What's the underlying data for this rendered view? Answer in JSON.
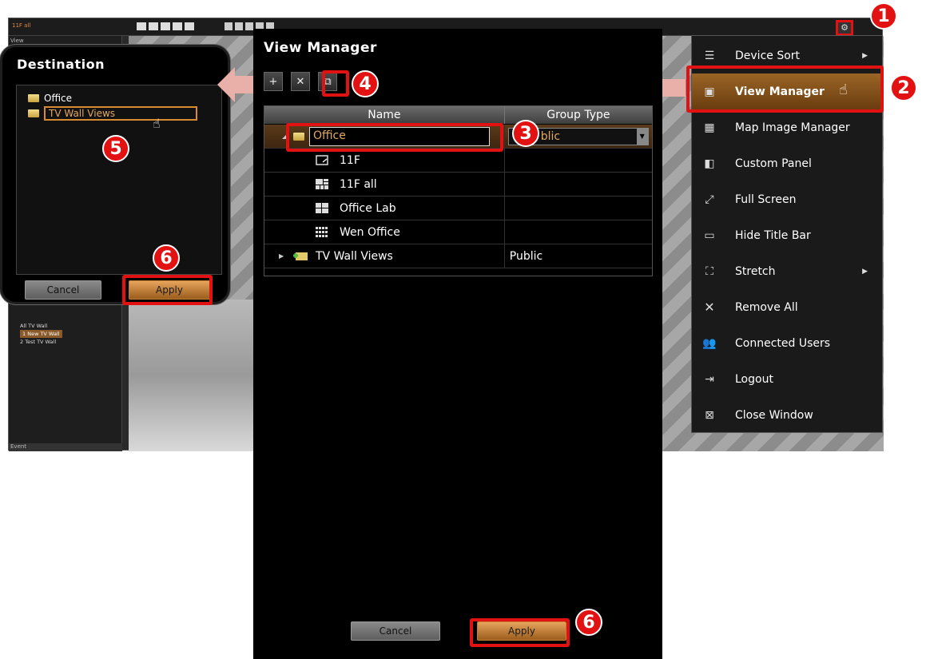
{
  "background_app": {
    "view_title": "11F all",
    "left_labels": [
      "View",
      "Event"
    ],
    "tv_wall_items": [
      "All TV Wall",
      "1 New TV Wall",
      "2 Test TV Wall"
    ]
  },
  "destination": {
    "title": "Destination",
    "items": [
      "Office",
      "TV Wall Views"
    ],
    "cancel_label": "Cancel",
    "apply_label": "Apply"
  },
  "view_manager": {
    "title": "View Manager",
    "toolbar": [
      "new-folder-icon",
      "delete-icon",
      "copy-icon"
    ],
    "columns": [
      "Name",
      "Group Type"
    ],
    "rows": [
      {
        "name": "Office",
        "group_type": "Public",
        "type": "folder",
        "selected": true
      },
      {
        "name": "11F",
        "group_type": "",
        "type": "view"
      },
      {
        "name": "11F all",
        "group_type": "",
        "type": "view"
      },
      {
        "name": "Office Lab",
        "group_type": "",
        "type": "view"
      },
      {
        "name": "Wen Office",
        "group_type": "",
        "type": "view"
      },
      {
        "name": "TV Wall Views",
        "group_type": "Public",
        "type": "tvwall-folder"
      }
    ],
    "group_select_value": "blic",
    "cancel_label": "Cancel",
    "apply_label": "Apply"
  },
  "menu": {
    "items": [
      {
        "label": "Device Sort",
        "icon": "sort-icon",
        "submenu": true
      },
      {
        "label": "View Manager",
        "icon": "view-manager-icon",
        "highlighted": true
      },
      {
        "label": "Map Image Manager",
        "icon": "map-image-icon"
      },
      {
        "label": "Custom Panel",
        "icon": "panel-icon"
      },
      {
        "label": "Full Screen",
        "icon": "fullscreen-icon"
      },
      {
        "label": "Hide Title Bar",
        "icon": "titlebar-icon"
      },
      {
        "label": "Stretch",
        "icon": "stretch-icon",
        "submenu": true
      },
      {
        "label": "Remove All",
        "icon": "remove-icon"
      },
      {
        "label": "Connected Users",
        "icon": "users-icon"
      },
      {
        "label": "Logout",
        "icon": "logout-icon"
      },
      {
        "label": "Close Window",
        "icon": "close-window-icon"
      }
    ]
  },
  "badges": [
    "1",
    "2",
    "3",
    "4",
    "5",
    "6",
    "6"
  ],
  "colors": {
    "accent": "#e5a861",
    "highlight": "#e21212",
    "menu_highlight": "#9a6426"
  }
}
